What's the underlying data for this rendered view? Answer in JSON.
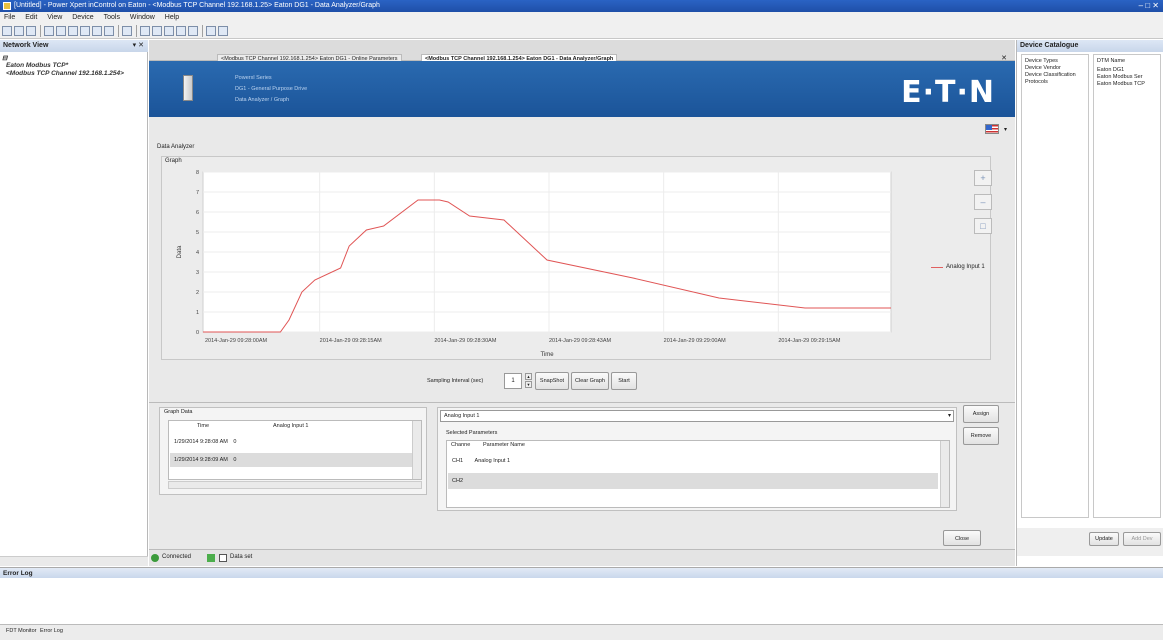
{
  "window": {
    "title": "[Untitled] - Power Xpert inControl on Eaton - <Modbus TCP Channel 192.168.1.25> Eaton DG1 - Data Analyzer/Graph",
    "controls": "–  □  ✕"
  },
  "menu": [
    "File",
    "Edit",
    "View",
    "Device",
    "Tools",
    "Window",
    "Help"
  ],
  "network_view": {
    "title": "Network View",
    "controls": "▾ ✕",
    "items": [
      "Eaton Modbus TCP*",
      "<Modbus TCP Channel 192.168.1.254>"
    ]
  },
  "tabs": [
    {
      "label": "<Modbus TCP Channel 192.168.1.254> Eaton DG1 - Online Parameters",
      "active": false
    },
    {
      "label": "<Modbus TCP Channel 192.168.1.254> Eaton DG1 - Data Analyzer/Graph",
      "active": true
    }
  ],
  "tab_close": "✕",
  "banner": {
    "lines": [
      "Powerxl Series",
      "DG1 - General Purpose Drive",
      "Data Analyzer / Graph"
    ],
    "logo": "E·T·N"
  },
  "data_analyzer_label": "Data Analyzer",
  "graph_label": "Graph",
  "zoom_icons": [
    "+",
    "–",
    "□"
  ],
  "chart_data": {
    "type": "line",
    "xlabel": "Time",
    "ylabel": "Data",
    "ylim": [
      0,
      8
    ],
    "yticks": [
      0,
      1,
      2,
      3,
      4,
      5,
      6,
      7,
      8
    ],
    "x_tick_labels": [
      "2014-Jan-29 09:28:00AM",
      "2014-Jan-29 09:28:15AM",
      "2014-Jan-29 09:28:30AM",
      "2014-Jan-29 09:28:43AM",
      "2014-Jan-29 09:29:00AM",
      "2014-Jan-29 09:29:15AM"
    ],
    "xlim": [
      0,
      80
    ],
    "series": [
      {
        "name": "Analog Input 1",
        "color": "#e05555",
        "x": [
          0,
          9,
          10,
          11.5,
          13,
          16,
          17,
          19,
          21,
          25,
          27.5,
          28.5,
          31,
          35,
          40,
          50,
          60,
          70,
          80
        ],
        "y": [
          0,
          0,
          0.6,
          2.0,
          2.6,
          3.2,
          4.3,
          5.1,
          5.3,
          6.6,
          6.6,
          6.5,
          5.8,
          5.6,
          3.6,
          2.7,
          1.7,
          1.2,
          1.2
        ]
      }
    ],
    "grid": true,
    "legend_position": "right"
  },
  "sampling": {
    "label": "Sampling Interval (sec)",
    "value": "1",
    "snapshot": "SnapShot",
    "clear": "Clear Graph",
    "start": "Start"
  },
  "graph_data": {
    "title": "Graph Data",
    "columns": [
      "Time",
      "Analog Input 1"
    ],
    "rows": [
      [
        "1/29/2014 9:28:08 AM",
        "0"
      ],
      [
        "1/29/2014 9:28:09 AM",
        "0"
      ]
    ]
  },
  "parameters": {
    "selected_value": "Analog Input 1",
    "assign": "Assign",
    "remove": "Remove",
    "selected_label": "Selected Parameters",
    "columns": [
      "Channe",
      "Parameter Name"
    ],
    "rows": [
      [
        "CH1",
        "Analog Input 1"
      ],
      [
        "CH2",
        ""
      ]
    ]
  },
  "close_button": "Close",
  "status": {
    "connected": "Connected",
    "dataset": "Data set"
  },
  "catalogue": {
    "title": "Device Catalogue",
    "left_items": [
      "Device Types",
      "Device Vendor",
      "Device Classification",
      "Protocols"
    ],
    "right_items": [
      "DTM Name",
      "Eaton DG1",
      "Eaton Modbus Ser",
      "Eaton Modbus TCP"
    ],
    "update": "Update",
    "add": "Add Dev"
  },
  "error_log": {
    "title": "Error Log"
  },
  "bottom_tabs": [
    "FDT Monitor",
    "Error Log"
  ]
}
